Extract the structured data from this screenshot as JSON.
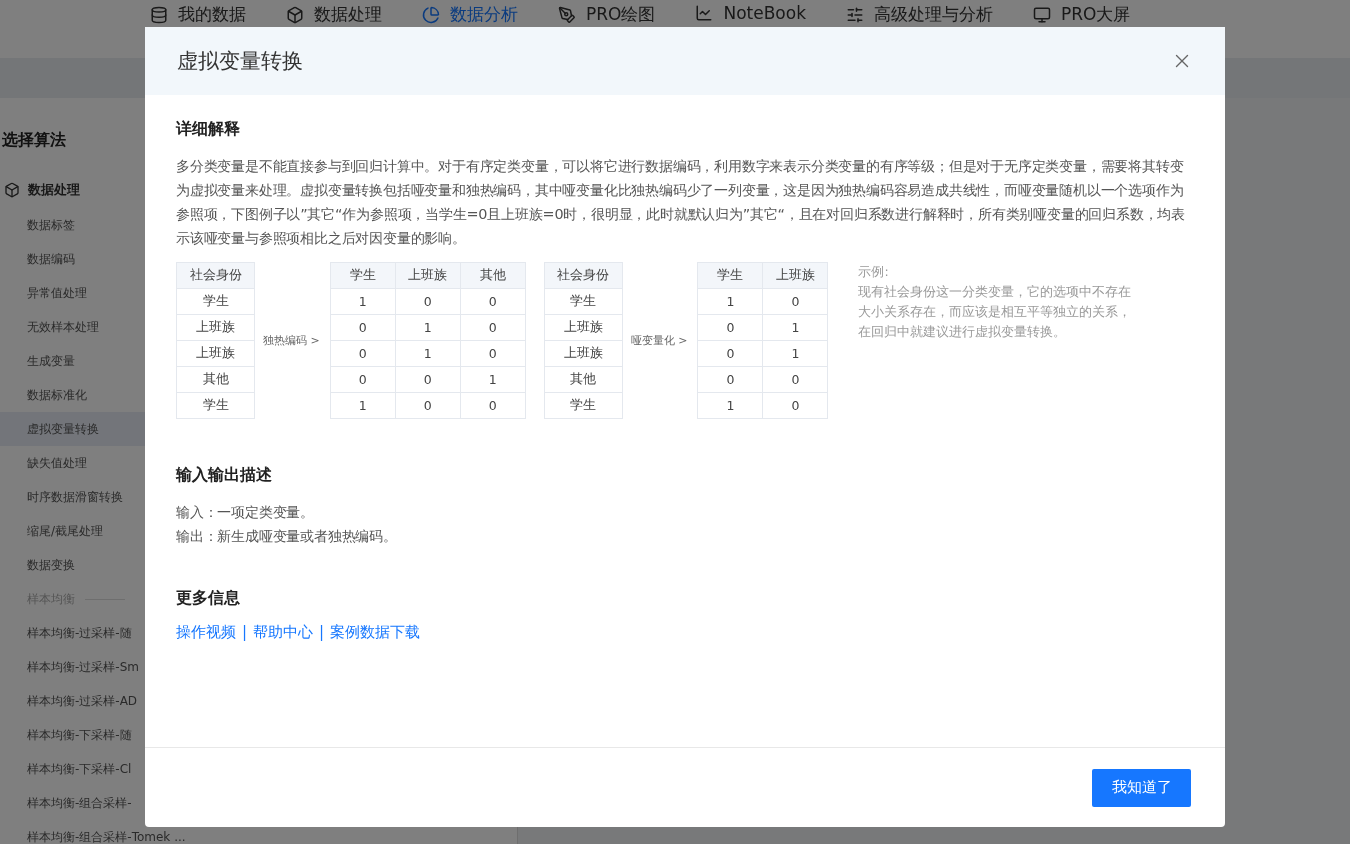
{
  "nav": {
    "items": [
      {
        "label": "我的数据",
        "selected": false
      },
      {
        "label": "数据处理",
        "selected": false
      },
      {
        "label": "数据分析",
        "selected": true
      },
      {
        "label": "PRO绘图",
        "selected": false
      },
      {
        "label": "NoteBook",
        "selected": false
      },
      {
        "label": "高级处理与分析",
        "selected": false
      },
      {
        "label": "PRO大屏",
        "selected": false
      }
    ]
  },
  "sidebar": {
    "title": "选择算法",
    "groups": [
      {
        "label": "数据处理",
        "children": [
          {
            "label": "数据标签",
            "selected": false
          },
          {
            "label": "数据编码",
            "selected": false
          },
          {
            "label": "异常值处理",
            "selected": false
          },
          {
            "label": "无效样本处理",
            "selected": false
          },
          {
            "label": "生成变量",
            "selected": false
          },
          {
            "label": "数据标准化",
            "selected": false
          },
          {
            "label": "虚拟变量转换",
            "selected": true
          },
          {
            "label": "缺失值处理",
            "selected": false
          },
          {
            "label": "时序数据滑窗转换",
            "selected": false
          },
          {
            "label": "缩尾/截尾处理",
            "selected": false
          },
          {
            "label": "数据变换",
            "selected": false
          }
        ]
      }
    ],
    "section": "样本均衡",
    "items": [
      {
        "label": "样本均衡-过采样-随",
        "selected": false
      },
      {
        "label": "样本均衡-过采样-Sm",
        "selected": false
      },
      {
        "label": "样本均衡-过采样-AD",
        "selected": false
      },
      {
        "label": "样本均衡-下采样-随",
        "selected": false
      },
      {
        "label": "样本均衡-下采样-Cl",
        "selected": false
      },
      {
        "label": "样本均衡-组合采样-",
        "selected": false
      },
      {
        "label": "样本均衡-组合采样-Tomek ...",
        "selected": false
      }
    ]
  },
  "modal": {
    "title": "虚拟变量转换",
    "sections": [
      {
        "heading": "详细解释",
        "paragraphs": [
          "多分类变量是不能直接参与到回归计算中。对于有序定类变量，可以将它进行数据编码，利用数字来表示分类变量的有序等级；但是对于无序定类变量，需要将其转变为虚拟变量来处理。虚拟变量转换包括哑变量和独热编码，其中哑变量化比独热编码少了一列变量，这是因为独热编码容易造成共线性，而哑变量随机以一个选项作为参照项，下图例子以”其它“作为参照项，当学生=0且上班族=0时，很明显，此时就默认归为”其它“，且在对回归系数进行解释时，所有类别哑变量的回归系数，均表示该哑变量与参照项相比之后对因变量的影响。"
        ],
        "example": {
          "blocks": [
            {
              "kind": "table",
              "columns": [
                "社会身份"
              ],
              "rows": [
                [
                  "学生"
                ],
                [
                  "上班族"
                ],
                [
                  "上班族"
                ],
                [
                  "其他"
                ],
                [
                  "学生"
                ]
              ]
            },
            {
              "kind": "arrow",
              "label": "独热编码 >"
            },
            {
              "kind": "table",
              "columns": [
                "学生",
                "上班族",
                "其他"
              ],
              "rows": [
                [
                  "1",
                  "0",
                  "0"
                ],
                [
                  "0",
                  "1",
                  "0"
                ],
                [
                  "0",
                  "1",
                  "0"
                ],
                [
                  "0",
                  "0",
                  "1"
                ],
                [
                  "1",
                  "0",
                  "0"
                ]
              ]
            },
            {
              "kind": "table",
              "columns": [
                "社会身份"
              ],
              "rows": [
                [
                  "学生"
                ],
                [
                  "上班族"
                ],
                [
                  "上班族"
                ],
                [
                  "其他"
                ],
                [
                  "学生"
                ]
              ]
            },
            {
              "kind": "arrow",
              "label": "哑变量化 >"
            },
            {
              "kind": "table",
              "columns": [
                "学生",
                "上班族"
              ],
              "rows": [
                [
                  "1",
                  "0"
                ],
                [
                  "0",
                  "1"
                ],
                [
                  "0",
                  "1"
                ],
                [
                  "0",
                  "0"
                ],
                [
                  "1",
                  "0"
                ]
              ]
            },
            {
              "kind": "note",
              "title": "示例:",
              "text": "现有社会身份这一分类变量，它的选项中不存在大小关系存在，而应该是相互平等独立的关系，在回归中就建议进行虚拟变量转换。"
            }
          ]
        }
      },
      {
        "heading": "输入输出描述",
        "paragraphs": [
          "输入：一项定类变量。",
          "输出：新生成哑变量或者独热编码。"
        ]
      },
      {
        "heading": "更多信息",
        "links": [
          "操作视频",
          "帮助中心",
          "案例数据下载"
        ],
        "separator": "|"
      }
    ],
    "button": "我知道了"
  }
}
